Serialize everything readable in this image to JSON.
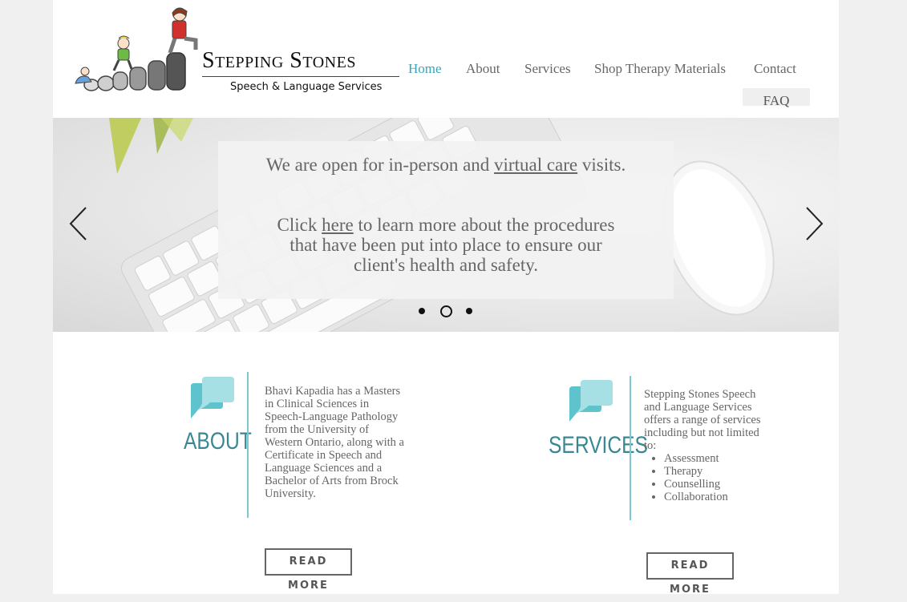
{
  "header": {
    "brand": "Stepping Stones",
    "tagline": "Speech & Language Services",
    "nav": [
      {
        "label": "Home",
        "active": true
      },
      {
        "label": "About"
      },
      {
        "label": "Services"
      },
      {
        "label": "Shop Therapy Materials"
      },
      {
        "label": "Contact"
      }
    ],
    "faq": "FAQ"
  },
  "slider": {
    "line1_pre": "We are open for in-person and ",
    "line1_link": "virtual care",
    "line1_post": " visits.",
    "line2_pre": "Click ",
    "line2_link": "here",
    "line2_post": " to learn more about the procedures that have been put into place to ensure our client's health and safety.",
    "current_slide": 2,
    "slide_count": 3
  },
  "about": {
    "title": "ABOUT",
    "text": "Bhavi Kapadia has a Masters in Clinical Sciences in Speech-Language Pathology from the University of Western Ontario, along with a Certificate in Speech and Language Sciences and a Bachelor of Arts from Brock University.",
    "button": "READ MORE",
    "icon": "speech-bubbles-icon"
  },
  "services": {
    "title": "SERVICES",
    "intro": "Stepping Stones Speech and Language Services offers a range of services including but not limited to:",
    "items": [
      "Assessment",
      "Therapy",
      "Counselling",
      "Collaboration"
    ],
    "button": "READ MORE",
    "icon": "speech-bubbles-icon"
  },
  "colors": {
    "accent": "#3aa4b4",
    "bubble_light": "#a7e0e4",
    "bubble_dark": "#5ec3cc",
    "text": "#666666"
  }
}
